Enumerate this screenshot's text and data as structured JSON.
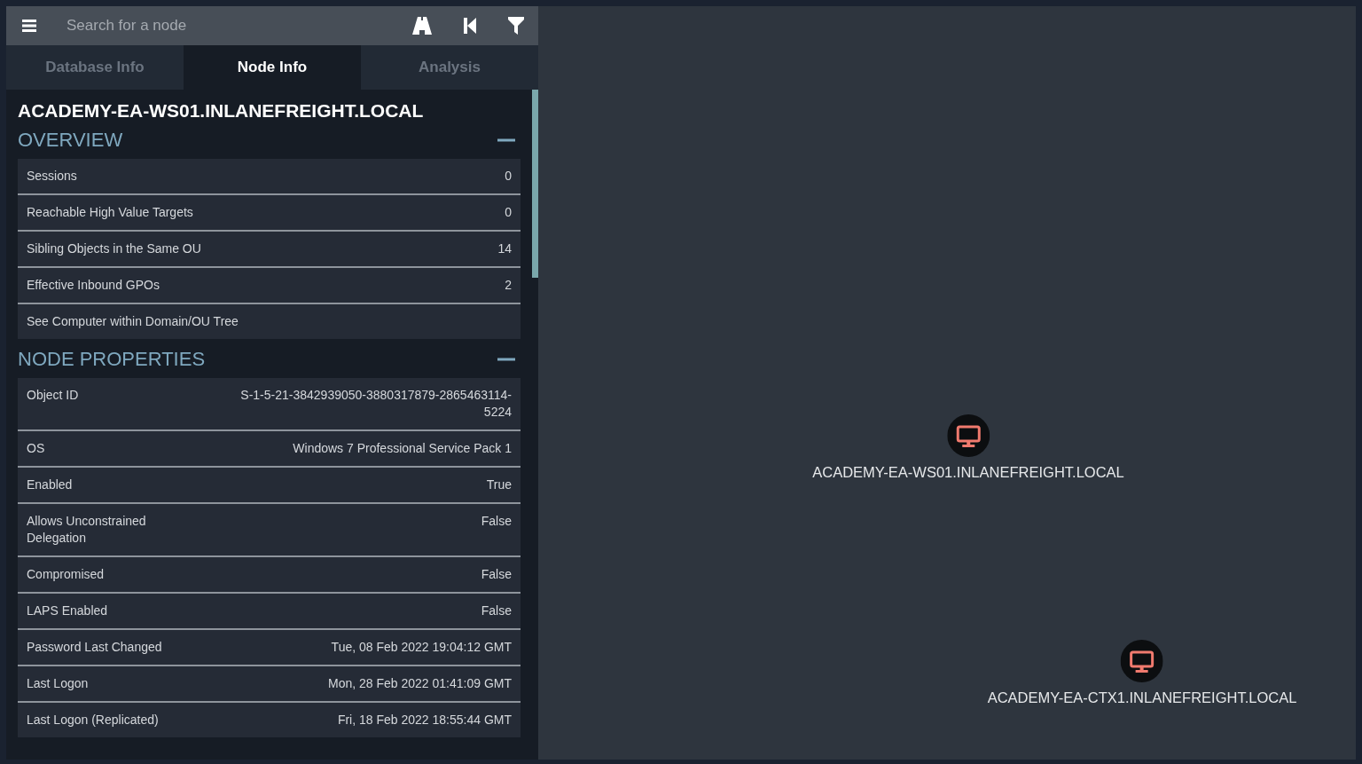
{
  "search": {
    "placeholder": "Search for a node"
  },
  "tabs": [
    {
      "label": "Database Info",
      "selected": false
    },
    {
      "label": "Node Info",
      "selected": true
    },
    {
      "label": "Analysis",
      "selected": false
    }
  ],
  "node_title": "ACADEMY-EA-WS01.INLANEFREIGHT.LOCAL",
  "sections": [
    {
      "title": "OVERVIEW",
      "expanded": true,
      "rows": [
        {
          "label": "Sessions",
          "value": "0"
        },
        {
          "label": "Reachable High Value Targets",
          "value": "0"
        },
        {
          "label": "Sibling Objects in the Same OU",
          "value": "14"
        },
        {
          "label": "Effective Inbound GPOs",
          "value": "2"
        },
        {
          "label": "See Computer within Domain/OU Tree"
        }
      ]
    },
    {
      "title": "NODE PROPERTIES",
      "expanded": true,
      "rows": [
        {
          "label": "Object ID",
          "value": "S-1-5-21-3842939050-3880317879-2865463114-5224"
        },
        {
          "label": "OS",
          "value": "Windows 7 Professional Service Pack 1"
        },
        {
          "label": "Enabled",
          "value": "True"
        },
        {
          "label": "Allows Unconstrained Delegation",
          "value": "False"
        },
        {
          "label": "Compromised",
          "value": "False"
        },
        {
          "label": "LAPS Enabled",
          "value": "False"
        },
        {
          "label": "Password Last Changed",
          "value": "Tue, 08 Feb 2022 19:04:12 GMT"
        },
        {
          "label": "Last Logon",
          "value": "Mon, 28 Feb 2022 01:41:09 GMT"
        },
        {
          "label": "Last Logon (Replicated)",
          "value": "Fri, 18 Feb 2022 18:55:44 GMT"
        }
      ]
    }
  ],
  "graph": {
    "nodes": [
      {
        "kind": "computer",
        "label": "ACADEMY-EA-WS01.INLANEFREIGHT.LOCAL"
      },
      {
        "kind": "computer",
        "label": "ACADEMY-EA-CTX1.INLANEFREIGHT.LOCAL"
      }
    ]
  }
}
